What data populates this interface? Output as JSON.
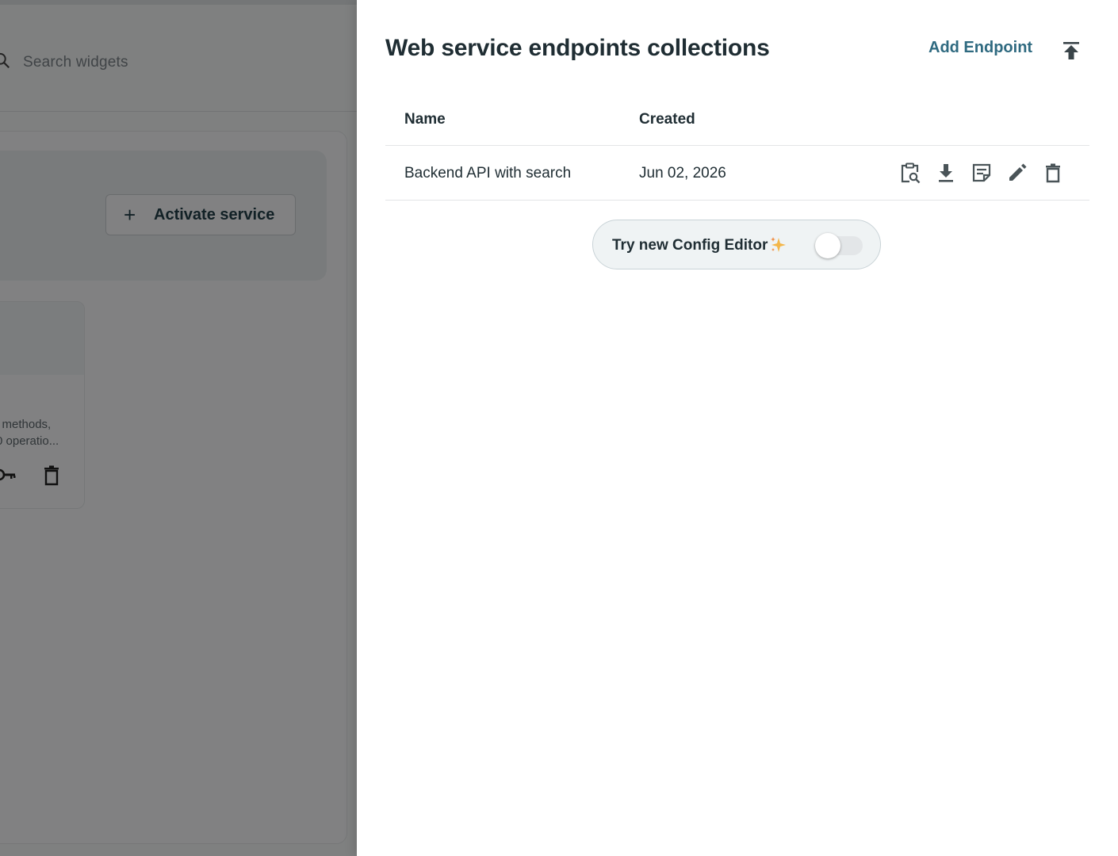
{
  "background": {
    "search": {
      "placeholder": "Search widgets"
    },
    "activate_button": {
      "plus": "+",
      "label": "Activate service"
    },
    "widget_card": {
      "description_line1": "l methods,",
      "description_line2": "0 operatio..."
    }
  },
  "drawer": {
    "title": "Web service endpoints collections",
    "add_endpoint_label": "Add Endpoint",
    "table": {
      "columns": [
        "Name",
        "Created"
      ],
      "rows": [
        {
          "name": "Backend API with search",
          "created": "Jun 02, 2026"
        }
      ],
      "row_actions": [
        "clipboard-search-icon",
        "download-icon",
        "notes-icon",
        "edit-icon",
        "delete-icon"
      ]
    },
    "config_toggle": {
      "label": "Try new Config Editor",
      "enabled": false
    }
  },
  "colors": {
    "accent": "#2f6a80",
    "text": "#1f2d33",
    "overlay": "rgba(0,0,0,0.48)"
  }
}
